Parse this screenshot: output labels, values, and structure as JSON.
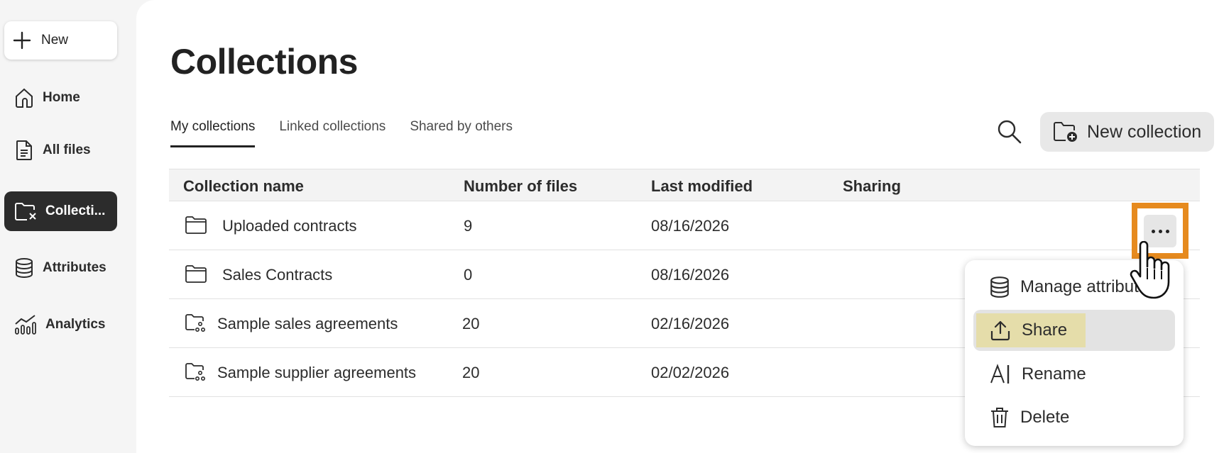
{
  "sidebar": {
    "new_label": "New",
    "items": [
      {
        "label": "Home",
        "icon": "home-icon"
      },
      {
        "label": "All files",
        "icon": "file-icon"
      },
      {
        "label": "Collecti...",
        "icon": "collections-icon",
        "active": true
      },
      {
        "label": "Attributes",
        "icon": "database-icon"
      },
      {
        "label": "Analytics",
        "icon": "analytics-icon"
      }
    ]
  },
  "main": {
    "title": "Collections",
    "tabs": [
      {
        "label": "My collections",
        "active": true
      },
      {
        "label": "Linked collections"
      },
      {
        "label": "Shared by others"
      }
    ],
    "new_collection_label": "New collection"
  },
  "table": {
    "columns": [
      "Collection name",
      "Number of files",
      "Last modified",
      "Sharing"
    ],
    "rows": [
      {
        "name": "Uploaded contracts",
        "files": "9",
        "modified": "08/16/2026",
        "icon": "folder-icon"
      },
      {
        "name": "Sales Contracts",
        "files": "0",
        "modified": "08/16/2026",
        "icon": "folder-icon"
      },
      {
        "name": "Sample sales agreements",
        "files": "20",
        "modified": "02/16/2026",
        "icon": "shared-folder-icon"
      },
      {
        "name": "Sample supplier agreements",
        "files": "20",
        "modified": "02/02/2026",
        "icon": "shared-folder-icon"
      }
    ]
  },
  "context_menu": {
    "items": [
      {
        "label": "Manage attribut",
        "icon": "database-icon"
      },
      {
        "label": "Share",
        "icon": "share-icon",
        "hover": true
      },
      {
        "label": "Rename",
        "icon": "rename-icon"
      },
      {
        "label": "Delete",
        "icon": "trash-icon"
      }
    ]
  },
  "colors": {
    "active_nav": "#2c2c2c",
    "focus_outline": "#e68a1e",
    "share_highlight": "#e5ddaa"
  }
}
